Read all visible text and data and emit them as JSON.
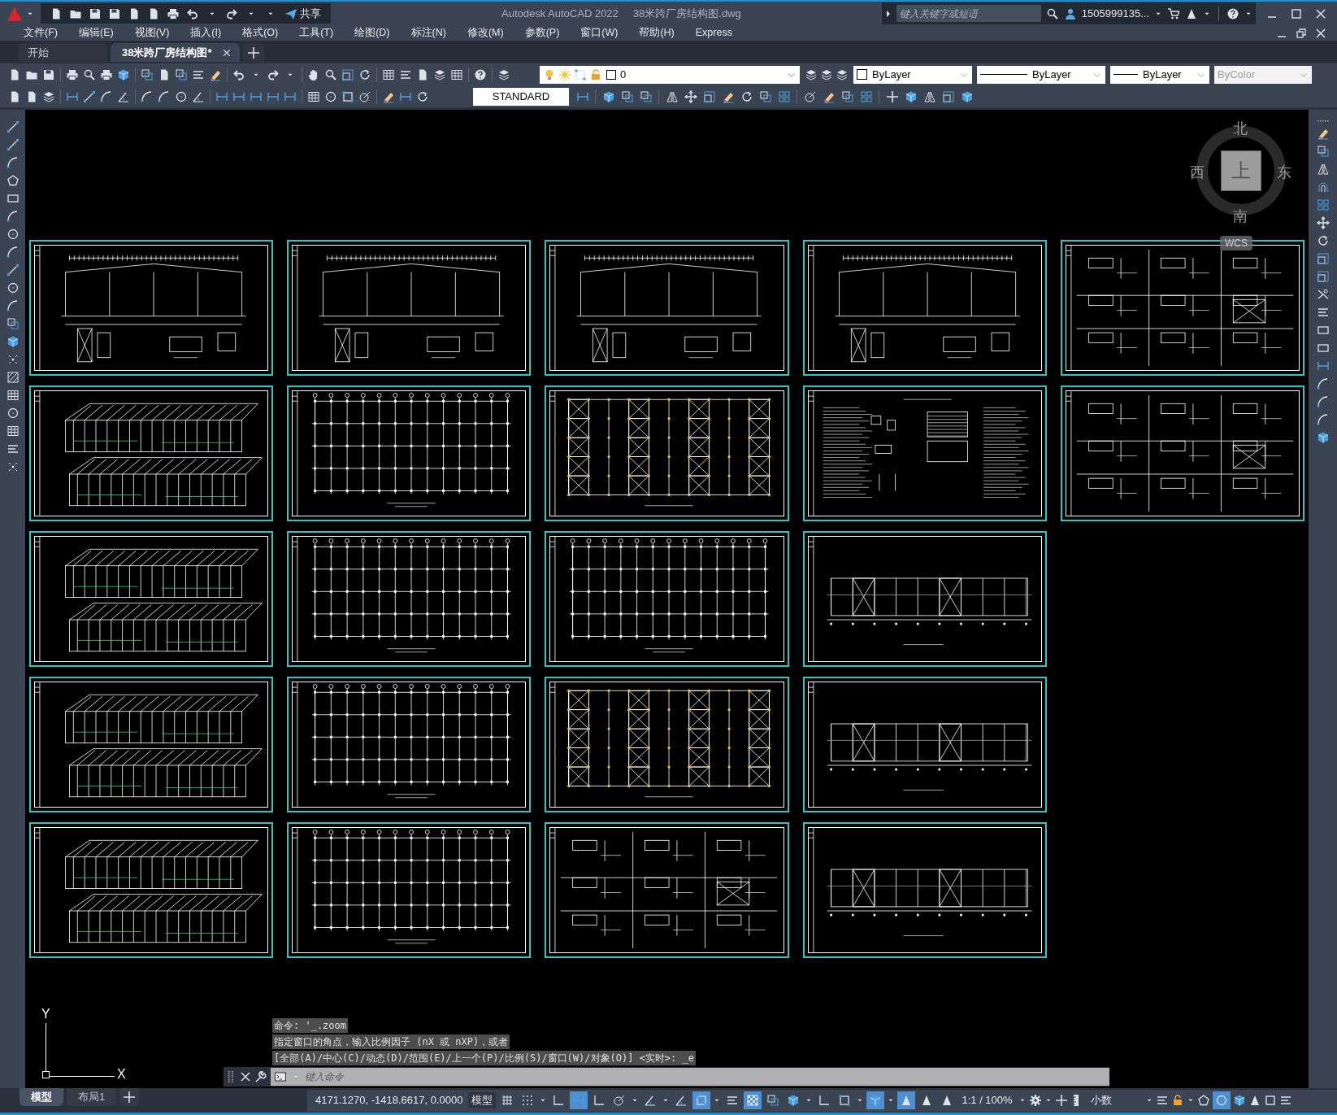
{
  "title_bar": {
    "app_title": "Autodesk AutoCAD 2022",
    "file_name": "38米跨厂房结构图.dwg",
    "share": "共享",
    "search": {
      "placeholder": "键入关键字或短语"
    },
    "user": "1505999135..."
  },
  "menu": [
    "文件(F)",
    "编辑(E)",
    "视图(V)",
    "插入(I)",
    "格式(O)",
    "工具(T)",
    "绘图(D)",
    "标注(N)",
    "修改(M)",
    "参数(P)",
    "窗口(W)",
    "帮助(H)",
    "Express"
  ],
  "document_tabs": [
    {
      "label": "开始",
      "selected": false
    },
    {
      "label": "38米跨厂房结构图*",
      "selected": true
    }
  ],
  "layer": {
    "name": "0"
  },
  "properties": [
    {
      "kind": "color",
      "value": "ByLayer",
      "disabled": false
    },
    {
      "kind": "linetype",
      "value": "ByLayer",
      "disabled": false
    },
    {
      "kind": "lineweight",
      "value": "ByLayer",
      "disabled": false
    },
    {
      "kind": "plotstyle",
      "value": "ByColor",
      "disabled": true
    }
  ],
  "text_style": "STANDARD",
  "viewcube": {
    "north": "北",
    "south": "南",
    "east": "东",
    "west": "西",
    "face": "上",
    "coordinate_system": "WCS"
  },
  "ucs_icon": {
    "x": "X",
    "y": "Y"
  },
  "sheets": [
    {
      "kind": "frame"
    },
    {
      "kind": "frame"
    },
    {
      "kind": "frame"
    },
    {
      "kind": "frame"
    },
    {
      "kind": "details"
    },
    {
      "kind": "isometric"
    },
    {
      "kind": "plan"
    },
    {
      "kind": "bracing"
    },
    {
      "kind": "notes"
    },
    {
      "kind": "details"
    },
    {
      "kind": "isometric"
    },
    {
      "kind": "plan"
    },
    {
      "kind": "plan"
    },
    {
      "kind": "wall"
    },
    {
      "kind": "isometric"
    },
    {
      "kind": "plan"
    },
    {
      "kind": "bracing"
    },
    {
      "kind": "wall"
    },
    {
      "kind": "isometric"
    },
    {
      "kind": "plan"
    },
    {
      "kind": "details"
    },
    {
      "kind": "wall"
    }
  ],
  "command_line": {
    "history": [
      "命令: '_.zoom",
      "指定窗口的角点，输入比例因子 (nX 或 nXP)，或者",
      "[全部(A)/中心(C)/动态(D)/范围(E)/上一个(P)/比例(S)/窗口(W)/对象(O)] <实时>: _e"
    ],
    "placeholder": "键入命令"
  },
  "layout_tabs": [
    {
      "label": "模型",
      "selected": true
    },
    {
      "label": "布局1",
      "selected": false
    }
  ],
  "status_bar": {
    "coordinates": "4171.1270, -1418.6617, 0.0000",
    "space": "模型",
    "toggles": [
      {
        "on": false
      },
      {
        "on": false
      },
      {
        "on": false
      },
      {
        "on": true
      },
      {
        "on": false
      },
      {
        "on": false
      },
      {
        "on": false
      },
      {
        "on": false
      },
      {
        "on": true
      },
      {
        "on": false
      },
      {
        "on": true
      },
      {
        "on": false
      },
      {
        "on": false
      },
      {
        "on": false
      },
      {
        "on": false
      },
      {
        "on": true
      },
      {
        "on": true
      },
      {
        "on": false
      },
      {
        "on": false
      },
      {
        "on": true
      }
    ],
    "annotation_scale": "1:1 / 100%",
    "units": "小数"
  }
}
